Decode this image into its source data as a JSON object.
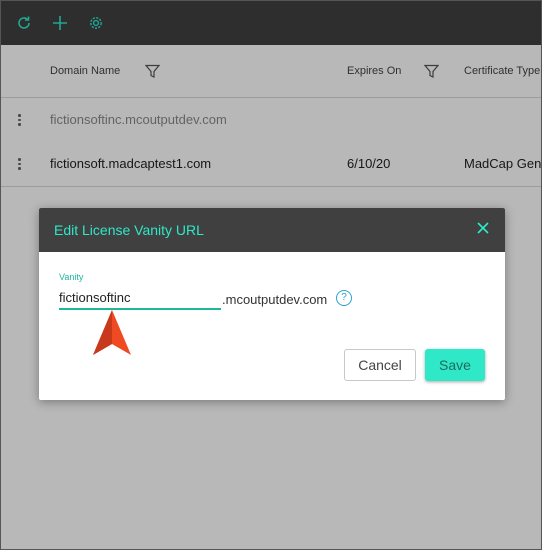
{
  "toolbar": {
    "refresh_icon": "refresh-icon",
    "add_icon": "plus-icon",
    "settings_icon": "gear-icon"
  },
  "table": {
    "columns": [
      "Domain Name",
      "Expires On",
      "Certificate Type"
    ],
    "rows": [
      {
        "domain": "fictionsoftinc.mcoutputdev.com",
        "expires": "",
        "certificate": ""
      },
      {
        "domain": "fictionsoft.madcaptest1.com",
        "expires": "6/10/20",
        "certificate": "MadCap Gene"
      }
    ]
  },
  "dialog": {
    "title": "Edit License Vanity URL",
    "vanity_label": "Vanity",
    "vanity_value": "fictionsoftinc",
    "suffix": ".mcoutputdev.com",
    "help_glyph": "?",
    "cancel_label": "Cancel",
    "save_label": "Save"
  },
  "colors": {
    "accent": "#2ee8c8",
    "toolbar_bg": "#404040",
    "pointer": "#f04a23"
  }
}
